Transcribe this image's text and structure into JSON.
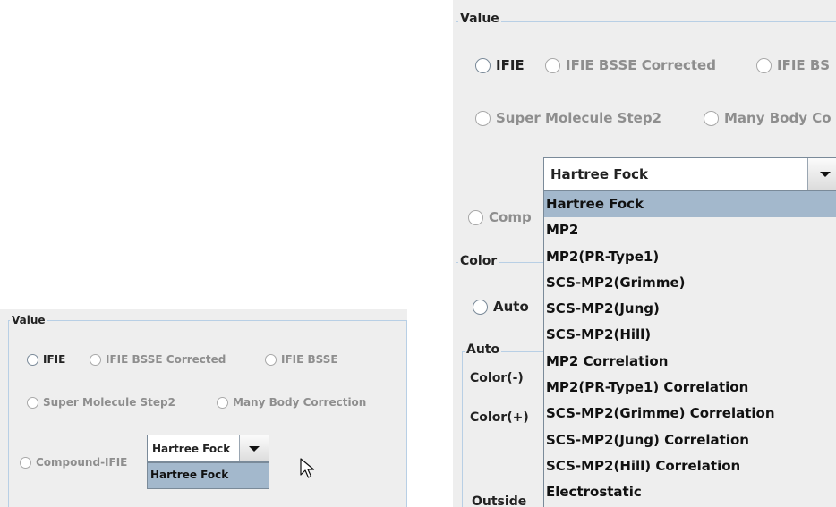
{
  "left": {
    "value_group": {
      "title": "Value",
      "radios": [
        {
          "label": "IFIE",
          "selected": true,
          "enabled": true
        },
        {
          "label": "IFIE BSSE Corrected",
          "selected": false,
          "enabled": false
        },
        {
          "label": "IFIE BSSE",
          "selected": false,
          "enabled": false
        },
        {
          "label": "Super Molecule Step2",
          "selected": false,
          "enabled": false
        },
        {
          "label": "Many Body Correction",
          "selected": false,
          "enabled": false
        },
        {
          "label": "Compound-IFIE",
          "selected": false,
          "enabled": false
        }
      ],
      "combo": {
        "selected": "Hartree Fock",
        "popup_items": [
          "Hartree Fock"
        ]
      }
    }
  },
  "right": {
    "value_group": {
      "title": "Value",
      "radios": [
        {
          "label": "IFIE",
          "selected": true,
          "enabled": true
        },
        {
          "label": "IFIE BSSE Corrected",
          "selected": false,
          "enabled": false
        },
        {
          "label": "IFIE BS",
          "selected": false,
          "enabled": false
        },
        {
          "label": "Super Molecule Step2",
          "selected": false,
          "enabled": false
        },
        {
          "label": "Many Body Co",
          "selected": false,
          "enabled": false
        },
        {
          "label": "Comp",
          "selected": false,
          "enabled": false
        }
      ],
      "combo": {
        "selected": "Hartree Fock",
        "popup_items": [
          "Hartree Fock",
          "MP2",
          "MP2(PR-Type1)",
          "SCS-MP2(Grimme)",
          "SCS-MP2(Jung)",
          "SCS-MP2(Hill)",
          "MP2 Correlation",
          "MP2(PR-Type1) Correlation",
          "SCS-MP2(Grimme) Correlation",
          "SCS-MP2(Jung) Correlation",
          "SCS-MP2(Hill) Correlation",
          "Electrostatic"
        ],
        "highlighted_index": 0
      }
    },
    "color_group": {
      "title": "Color",
      "auto_radio": {
        "label": "Auto",
        "selected": true
      },
      "auto_group": {
        "title": "Auto",
        "color_minus_label": "Color(-)",
        "color_plus_label": "Color(+)",
        "outside_label": "Outside"
      }
    }
  }
}
